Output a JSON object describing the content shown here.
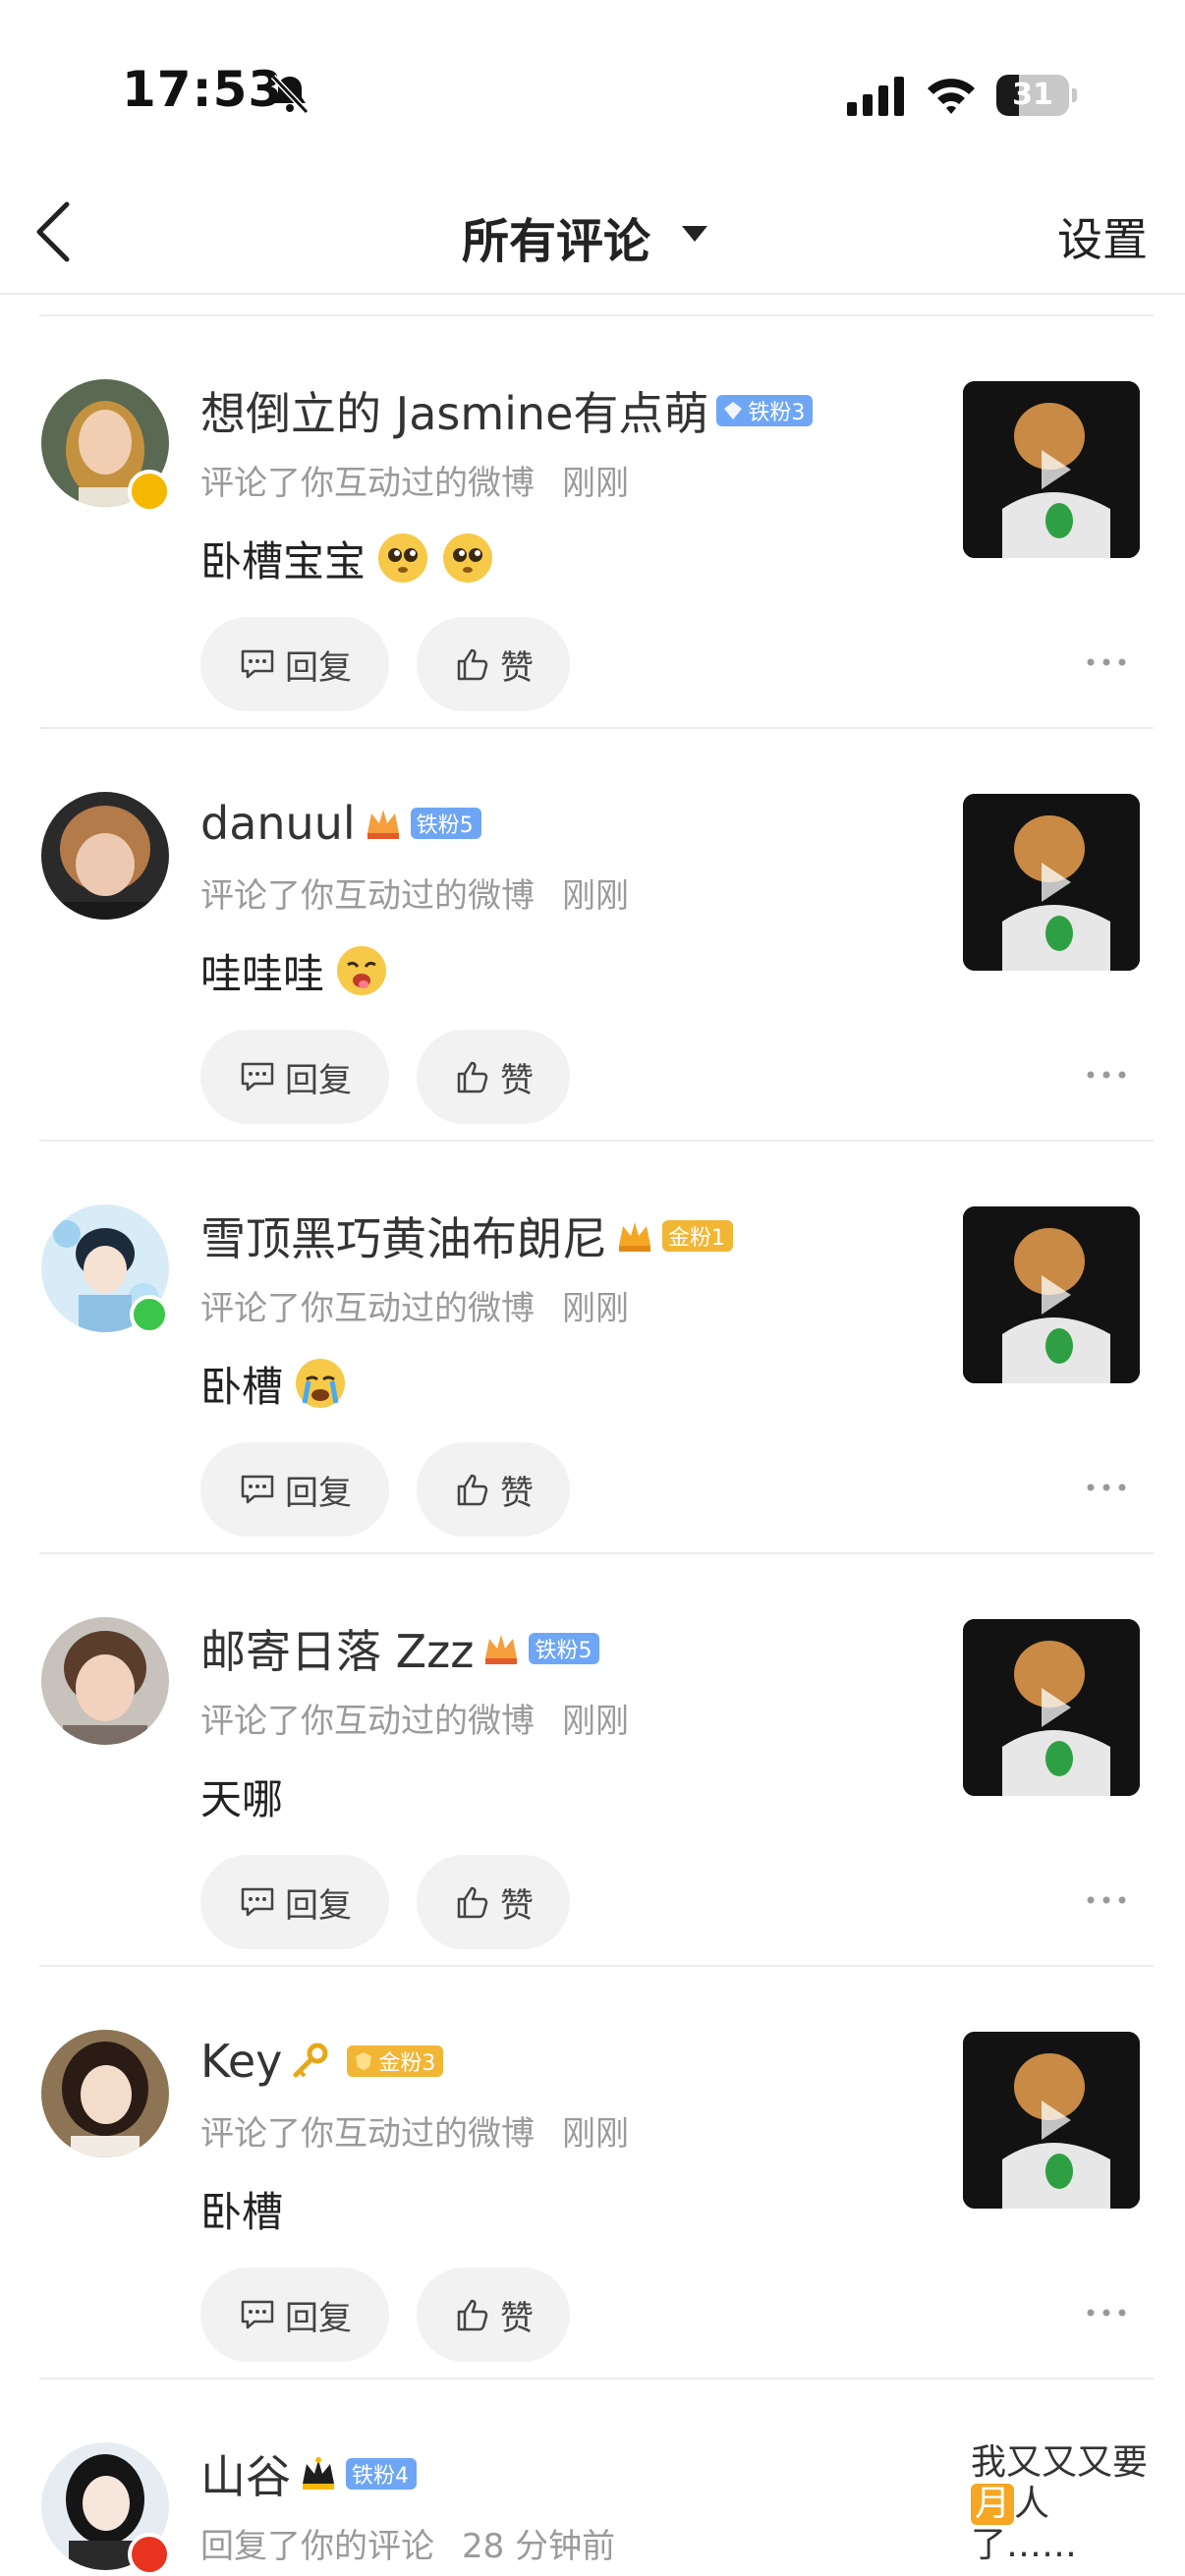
{
  "status_bar": {
    "time": "17:53",
    "battery_level": "31",
    "icons": [
      "bell-slash-icon",
      "signal-icon",
      "wifi-icon",
      "battery-icon"
    ]
  },
  "nav": {
    "title": "所有评论",
    "settings_label": "设置",
    "icons": [
      "back-chevron-icon",
      "caret-down-icon"
    ]
  },
  "actions": {
    "reply_label": "回复",
    "like_label": "赞"
  },
  "colors": {
    "badge_iron": "#6ea6f5",
    "badge_gold": "#f2b635",
    "verify_gold": "#f5b800",
    "verify_red": "#e8341f",
    "online_green": "#3bc54b",
    "quote_highlight": "#f5a623"
  },
  "comments": [
    {
      "name": "想倒立的 Jasmine有点萌",
      "badge": "铁粉3",
      "badge_type": "iron",
      "meta_action": "评论了你互动过的微博",
      "meta_time": "刚刚",
      "text": "卧槽宝宝",
      "emojis": [
        "pleading-face-emoji",
        "pleading-face-emoji"
      ]
    },
    {
      "name": "danuul",
      "badge": "铁粉5",
      "badge_type": "iron",
      "meta_action": "评论了你互动过的微博",
      "meta_time": "刚刚",
      "text": "哇哇哇",
      "emojis": [
        "drooling-face-emoji"
      ]
    },
    {
      "name": "雪顶黑巧黄油布朗尼",
      "badge": "金粉1",
      "badge_type": "gold",
      "meta_action": "评论了你互动过的微博",
      "meta_time": "刚刚",
      "text": "卧槽",
      "emojis": [
        "crying-face-emoji"
      ]
    },
    {
      "name": "邮寄日落 Zzz",
      "badge": "铁粉5",
      "badge_type": "iron",
      "meta_action": "评论了你互动过的微博",
      "meta_time": "刚刚",
      "text": "天哪",
      "emojis": []
    },
    {
      "name": "Key",
      "badge": "金粉3",
      "badge_type": "gold",
      "meta_action": "评论了你互动过的微博",
      "meta_time": "刚刚",
      "text": "卧槽",
      "emojis": [],
      "name_emoji": "key-emoji"
    },
    {
      "name": "山谷",
      "badge": "铁粉4",
      "badge_type": "iron",
      "meta_action": "回复了你的评论",
      "meta_time": "28 分钟前",
      "quote_part1": "我又又又要",
      "quote_highlight": "月",
      "quote_part2": "人",
      "quote_part3": "了……"
    }
  ]
}
